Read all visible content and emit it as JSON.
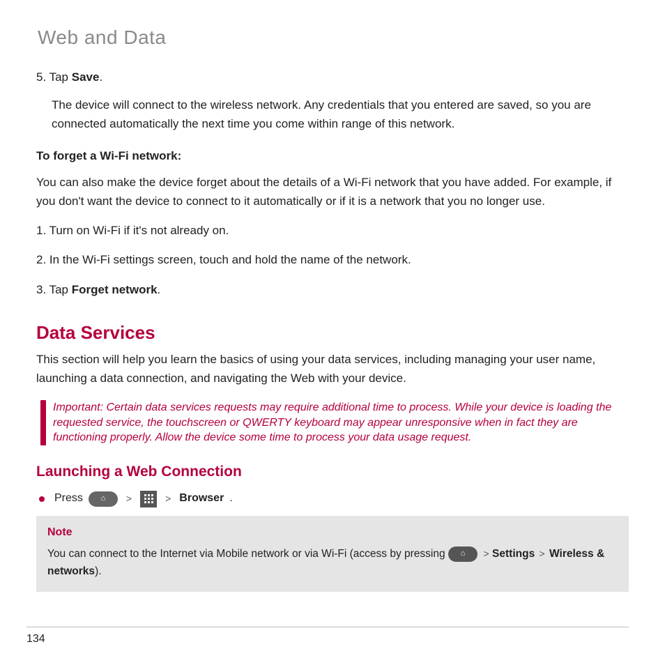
{
  "header": {
    "breadcrumb": "Web and Data"
  },
  "section1": {
    "step5_num": "5. ",
    "step5_pre": "Tap ",
    "step5_bold": "Save",
    "step5_post": ".",
    "step5_explain": "The device will connect to the wireless network. Any credentials that you entered are saved, so you are connected automatically the next time you come within range of this network.",
    "forget_heading": "To forget a Wi-Fi network:",
    "forget_para": "You can also make the device forget about the details of a Wi-Fi network that you have added. For example, if you don't want the device to connect to it automatically or if it is a network that you no longer use.",
    "f1": "1. Turn on Wi-Fi if it's not already on.",
    "f2": "2. In the Wi-Fi settings screen, touch and hold the name of the network.",
    "f3_pre": "3. Tap ",
    "f3_bold": "Forget network",
    "f3_post": "."
  },
  "data_services": {
    "title": "Data Services",
    "intro": "This section will help you learn the basics of using your data services, including managing your user name, launching a data connection, and navigating the Web with your device.",
    "important_label": "Important:",
    "important_body": "  Certain data services requests may require additional time to process. While your device is loading the requested service, the touchscreen or QWERTY keyboard may appear unresponsive when in fact they are functioning properly. Allow the device some time to process your data usage request."
  },
  "launching": {
    "title": "Launching a Web Connection",
    "press": "Press",
    "chev": ">",
    "browser_bold": "Browser",
    "period": "."
  },
  "note": {
    "label": "Note",
    "pre": "You can connect to the Internet via Mobile network or via Wi-Fi (access by pressing ",
    "chev": ">",
    "settings": "Settings",
    "wireless": "Wireless & networks",
    "close": ")."
  },
  "icons": {
    "home": "⌂",
    "apps": "⋮⋮⋮"
  },
  "page_number": "134"
}
